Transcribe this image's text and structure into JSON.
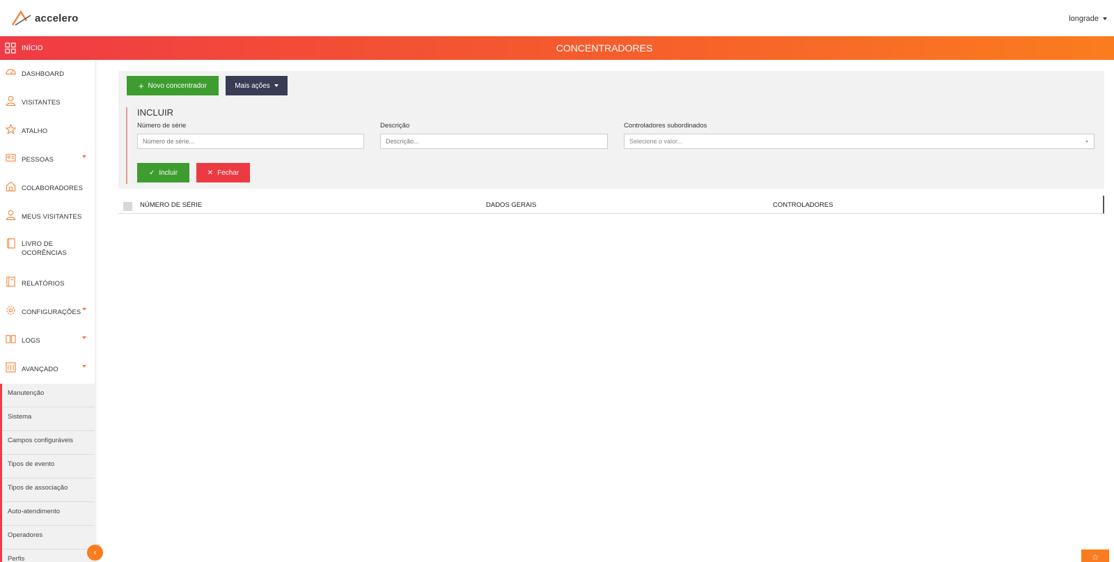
{
  "app": {
    "logo_text": "accelero",
    "user": "longrade"
  },
  "header": {
    "home_label": "INÍCIO",
    "page_title": "CONCENTRADORES"
  },
  "sidebar": {
    "items": [
      {
        "label": "DASHBOARD",
        "icon": "dashboard-icon"
      },
      {
        "label": "VISITANTES",
        "icon": "user-icon"
      },
      {
        "label": "ATALHO",
        "icon": "star-icon"
      },
      {
        "label": "PESSOAS",
        "icon": "id-card-icon",
        "has_submenu": true
      },
      {
        "label": "COLABORADORES",
        "icon": "building-icon"
      },
      {
        "label": "MEUS VISITANTES",
        "icon": "user-icon"
      },
      {
        "label": "LIVRO DE OCORÊNCIAS",
        "icon": "book-icon"
      },
      {
        "label": "RELATÓRIOS",
        "icon": "report-icon"
      },
      {
        "label": "CONFIGURAÇÕES",
        "icon": "gear-icon",
        "has_submenu": true
      },
      {
        "label": "LOGS",
        "icon": "open-book-icon",
        "has_submenu": true
      },
      {
        "label": "AVANÇADO",
        "icon": "advanced-icon",
        "has_submenu": true
      }
    ],
    "submenu": [
      "Manutenção",
      "Sistema",
      "Campos configuráveis",
      "Tipos de evento",
      "Tipos de associação",
      "Auto-atendimento",
      "Operadores",
      "Perfis"
    ]
  },
  "toolbar": {
    "new_label": "Novo concentrador",
    "more_label": "Mais ações"
  },
  "form": {
    "title": "INCLUIR",
    "serial_label": "Número de série",
    "serial_placeholder": "Número de série...",
    "description_label": "Descrição",
    "description_placeholder": "Descrição...",
    "controllers_label": "Controladores subordinados",
    "controllers_placeholder": "Selecione o valor...",
    "include_label": "Incluir",
    "close_label": "Fechar"
  },
  "table": {
    "columns": [
      "NÚMERO DE SÉRIE",
      "DADOS GERAIS",
      "CONTROLADORES"
    ]
  },
  "colors": {
    "accent": "#fb7c1f",
    "red": "#ef3b45",
    "green": "#3d9d2e",
    "dark": "#393c54"
  }
}
